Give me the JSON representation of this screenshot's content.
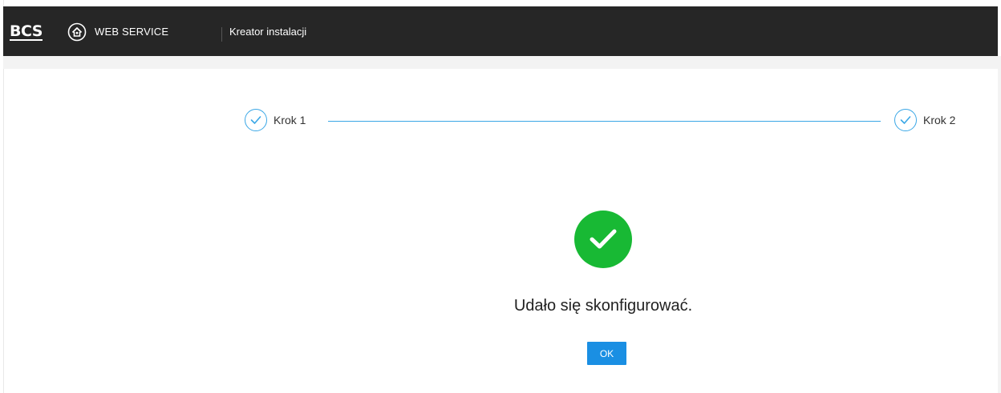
{
  "header": {
    "logo_text": "BCS",
    "brand": "WEB SERVICE",
    "title": "Kreator instalacji"
  },
  "steps": [
    {
      "label": "Krok 1",
      "status": "completed",
      "icon": "check-circle-icon"
    },
    {
      "label": "Krok 2",
      "status": "completed",
      "icon": "check-circle-icon"
    }
  ],
  "result": {
    "icon": "success-check-icon",
    "message": "Udało się skonfigurować.",
    "ok_label": "OK"
  },
  "colors": {
    "header_bg": "#262626",
    "accent": "#3aa7e6",
    "success": "#18b934",
    "button": "#1a8fe3"
  }
}
